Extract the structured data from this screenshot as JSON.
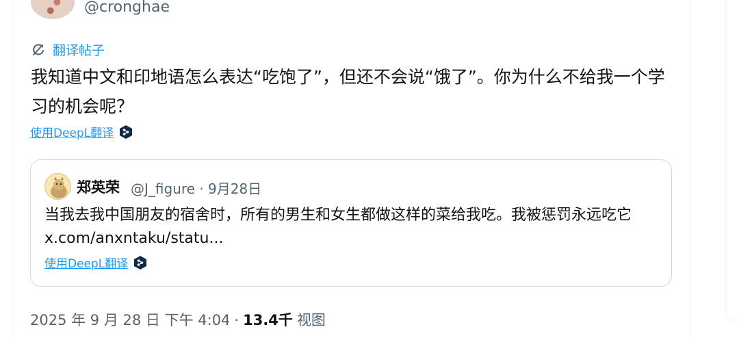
{
  "author": {
    "handle": "@cronghae"
  },
  "post": {
    "translate_label": "翻译帖子",
    "text": "我知道中文和印地语怎么表达“吃饱了”，但还不会说“饿了”。你为什么不给我一个学习的机会呢？",
    "deepl_label": "使用DeepL翻译"
  },
  "quote": {
    "name": "郑英荣",
    "handle_date": "@J_figure · 9月28日",
    "text": "当我去我中国朋友的宿舍时，所有的男生和女生都做这样的菜给我吃。我被惩罚永远吃它 x.com/anxntaku/statu...",
    "deepl_label": "使用DeepL翻译"
  },
  "meta": {
    "timestamp": "2025 年 9 月 28 日 下午 4:04",
    "separator": "·",
    "views_count": "13.4千",
    "views_label": "视图"
  },
  "colors": {
    "link": "#1d9bf0",
    "secondary_text": "#536471",
    "primary_text": "#0f1419",
    "border": "#cfd9de"
  },
  "icons": [
    "translate-icon",
    "deepl-icon"
  ]
}
